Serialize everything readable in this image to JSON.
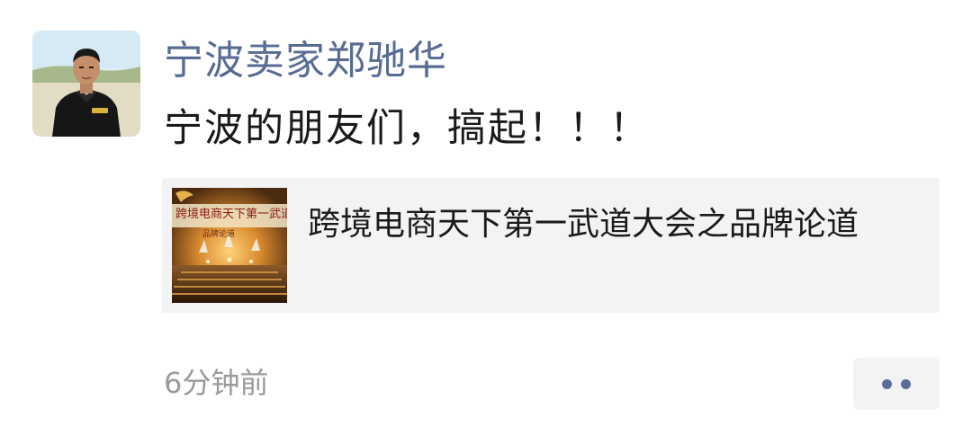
{
  "post": {
    "author_name": "宁波卖家郑驰华",
    "text": "宁波的朋友们，搞起！！！",
    "timestamp": "6分钟前"
  },
  "link_card": {
    "title": "跨境电商天下第一武道大会之品牌论道",
    "thumbnail_banner_text": "跨境电商天下第一武道",
    "thumbnail_sub_text": "品牌论道"
  },
  "actions": {
    "more_icon": "ellipsis-icon"
  },
  "colors": {
    "author_name": "#576b95",
    "body_text": "#1a1a1a",
    "timestamp": "#9a9a9a",
    "card_background": "#f3f3f5",
    "dots": "#5a6d99"
  }
}
